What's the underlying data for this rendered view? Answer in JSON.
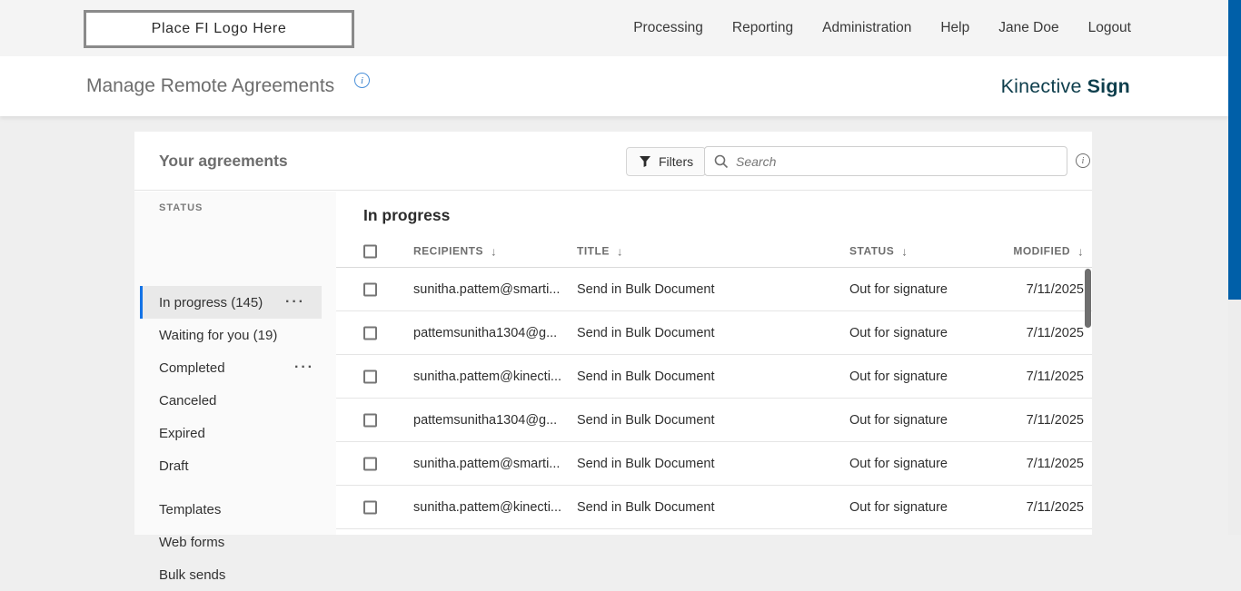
{
  "top_nav": {
    "logo_text": "Place FI Logo Here",
    "items": [
      "Processing",
      "Reporting",
      "Administration",
      "Help",
      "Jane Doe",
      "Logout"
    ]
  },
  "title_bar": {
    "title": "Manage Remote Agreements",
    "brand_regular": "Kinective",
    "brand_bold": "Sign"
  },
  "panel": {
    "header": {
      "title": "Your agreements",
      "filters_label": "Filters",
      "search_placeholder": "Search"
    },
    "sidebar": {
      "section_label": "STATUS",
      "items": [
        {
          "label": "In progress (145)"
        },
        {
          "label": "Waiting for you (19)"
        },
        {
          "label": "Completed"
        },
        {
          "label": "Canceled"
        },
        {
          "label": "Expired"
        },
        {
          "label": "Draft"
        },
        {
          "label": "Templates"
        },
        {
          "label": "Web forms"
        },
        {
          "label": "Bulk sends"
        }
      ]
    },
    "table": {
      "title": "In progress",
      "columns": [
        "RECIPIENTS",
        "TITLE",
        "STATUS",
        "MODIFIED"
      ],
      "rows": [
        {
          "recipient": "sunitha.pattem@smarti...",
          "title": "Send in Bulk Document",
          "status": "Out for signature",
          "modified": "7/11/2025"
        },
        {
          "recipient": "pattemsunitha1304@g...",
          "title": "Send in Bulk Document",
          "status": "Out for signature",
          "modified": "7/11/2025"
        },
        {
          "recipient": "sunitha.pattem@kinecti...",
          "title": "Send in Bulk Document",
          "status": "Out for signature",
          "modified": "7/11/2025"
        },
        {
          "recipient": "pattemsunitha1304@g...",
          "title": "Send in Bulk Document",
          "status": "Out for signature",
          "modified": "7/11/2025"
        },
        {
          "recipient": "sunitha.pattem@smarti...",
          "title": "Send in Bulk Document",
          "status": "Out for signature",
          "modified": "7/11/2025"
        },
        {
          "recipient": "sunitha.pattem@kinecti...",
          "title": "Send in Bulk Document",
          "status": "Out for signature",
          "modified": "7/11/2025"
        }
      ]
    }
  },
  "icons": {
    "sort_desc": "↓",
    "overflow": "···",
    "info": "i"
  },
  "colors": {
    "accent_blue": "#1473e6",
    "brand_teal": "#0e3e4c",
    "page_scrollbar_blue": "#005fa8",
    "topbar_bg": "#f4f4f4",
    "page_bg": "#efefef"
  }
}
